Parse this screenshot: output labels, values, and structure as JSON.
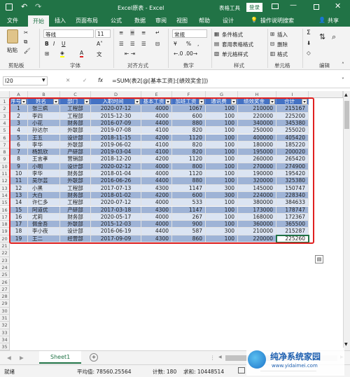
{
  "window": {
    "title": "Excel原表 - Excel",
    "tools_label": "表格工具",
    "login": "登录"
  },
  "tabs": [
    "文件",
    "开始",
    "插入",
    "页面布局",
    "公式",
    "数据",
    "审阅",
    "视图",
    "帮助",
    "设计"
  ],
  "tellme": "操作说明搜索",
  "share": "共享",
  "ribbon": {
    "clipboard": {
      "paste": "粘贴",
      "label": "剪贴板"
    },
    "font": {
      "name": "等线",
      "size": "11",
      "label": "字体",
      "bold": "B",
      "italic": "I",
      "underline": "U"
    },
    "alignment": {
      "label": "对齐方式"
    },
    "number": {
      "format": "常规",
      "label": "数字",
      "percent": "%"
    },
    "styles": {
      "conditional": "条件格式",
      "as_table": "套用表格格式",
      "cell_styles": "单元格样式",
      "label": "样式"
    },
    "cells": {
      "insert": "插入",
      "delete": "删除",
      "format": "格式",
      "label": "单元格"
    },
    "editing": {
      "sum": "Σ",
      "label": "编辑"
    }
  },
  "formula_bar": {
    "name_box": "I20",
    "fx": "fx",
    "formula": "=SUM(表2[@[基本工资]:[绩效奖金]])"
  },
  "columns": [
    "A",
    "B",
    "C",
    "D",
    "E",
    "F",
    "G",
    "H",
    "I"
  ],
  "table": {
    "headers": [
      "序号",
      "姓名",
      "部门",
      "入职时间",
      "基本工资",
      "加班工资",
      "通讯费",
      "绩效奖金",
      "合计"
    ],
    "rows": [
      [
        "1",
        "张三疯",
        "工程部",
        "2020-07-12",
        "4000",
        "1067",
        "100",
        "210000",
        "215167"
      ],
      [
        "2",
        "李四",
        "工程部",
        "2015-12-30",
        "4000",
        "600",
        "100",
        "220000",
        "225200"
      ],
      [
        "3",
        "小花",
        "财务部",
        "2016-07-09",
        "4400",
        "880",
        "100",
        "340000",
        "345380"
      ],
      [
        "4",
        "孙达尔",
        "外联部",
        "2019-07-08",
        "4100",
        "820",
        "100",
        "250000",
        "255020"
      ],
      [
        "5",
        "王五",
        "设计部",
        "2018-11-15",
        "4200",
        "1120",
        "100",
        "400000",
        "405420"
      ],
      [
        "6",
        "李华",
        "外联部",
        "2019-06-02",
        "4100",
        "820",
        "100",
        "180000",
        "185220"
      ],
      [
        "7",
        "杨凯欣",
        "产研部",
        "2019-03-04",
        "4100",
        "820",
        "100",
        "195000",
        "200020"
      ],
      [
        "8",
        "王言孝",
        "营销部",
        "2018-12-20",
        "4200",
        "1120",
        "100",
        "260000",
        "265420"
      ],
      [
        "9",
        "小明",
        "设计部",
        "2020-02-12",
        "4000",
        "800",
        "100",
        "270000",
        "274900"
      ],
      [
        "10",
        "李华",
        "财务部",
        "2018-01-04",
        "4000",
        "1120",
        "100",
        "190000",
        "195420"
      ],
      [
        "11",
        "吴尔芸",
        "外联部",
        "2016-06-26",
        "4400",
        "880",
        "100",
        "320000",
        "325380"
      ],
      [
        "12",
        "小黑",
        "工程部",
        "2017-07-13",
        "4300",
        "1147",
        "300",
        "145000",
        "150747"
      ],
      [
        "13",
        "大白",
        "财务部",
        "2018-01-02",
        "4200",
        "600",
        "300",
        "224000",
        "228340"
      ],
      [
        "14",
        "许仁多",
        "工程部",
        "2020-07-12",
        "4000",
        "533",
        "100",
        "380000",
        "384633"
      ],
      [
        "15",
        "阿道优",
        "产研部",
        "2017-03-18",
        "4300",
        "1147",
        "100",
        "173000",
        "178747"
      ],
      [
        "16",
        "尤莉",
        "财务部",
        "2020-05-17",
        "4000",
        "267",
        "100",
        "168000",
        "172367"
      ],
      [
        "17",
        "佩金吾",
        "外联部",
        "2015-12-03",
        "4000",
        "900",
        "100",
        "360000",
        "365500"
      ],
      [
        "18",
        "李小夜",
        "设计部",
        "2016-06-19",
        "4400",
        "587",
        "300",
        "210000",
        "215287"
      ],
      [
        "19",
        "王二",
        "经营部",
        "2017-09-09",
        "4300",
        "860",
        "100",
        "220000",
        "225260"
      ]
    ],
    "row_numbers": [
      "1",
      "2",
      "3",
      "4",
      "5",
      "6",
      "7",
      "8",
      "9",
      "10",
      "11",
      "12",
      "13",
      "14",
      "15",
      "16",
      "17",
      "18",
      "19",
      "20",
      "21",
      "22",
      "23",
      "24",
      "25",
      "26",
      "27",
      "28",
      "29",
      "30",
      "31",
      "32",
      "33",
      "34",
      "35"
    ]
  },
  "sheet_tab": "Sheet1",
  "status": {
    "ready": "就绪",
    "average": "平均值: 78560.25564",
    "count": "计数: 180",
    "sum": "求和: 10448514"
  },
  "watermark": {
    "line1": "纯净系统家园",
    "line2": "www.yidaimei.com"
  },
  "colors": {
    "accent": "#217346",
    "table_header": "#4472c4",
    "band_dark": "#9eb3d6",
    "band_light": "#dbe4f2",
    "highlight": "#e02020"
  }
}
